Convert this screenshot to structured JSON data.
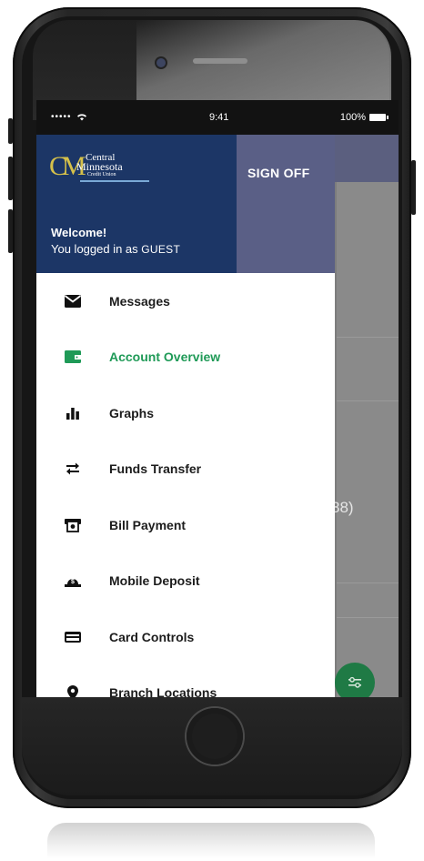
{
  "status_bar": {
    "signal": "•••••",
    "time": "9:41",
    "battery": "100%"
  },
  "header": {
    "logo": {
      "line1": "Central",
      "line2": "Minnesota",
      "line3": "Credit Union"
    },
    "sign_off_label": "SIGN OFF",
    "welcome": "Welcome!",
    "logged_in_prefix": "You logged in as ",
    "username": "GUEST"
  },
  "menu": {
    "items": [
      {
        "label": "Messages",
        "icon": "envelope-icon"
      },
      {
        "label": "Account Overview",
        "icon": "wallet-icon"
      },
      {
        "label": "Graphs",
        "icon": "bar-chart-icon"
      },
      {
        "label": "Funds Transfer",
        "icon": "transfer-arrows-icon"
      },
      {
        "label": "Bill Payment",
        "icon": "bill-icon"
      },
      {
        "label": "Mobile Deposit",
        "icon": "deposit-icon"
      },
      {
        "label": "Card Controls",
        "icon": "card-icon"
      },
      {
        "label": "Branch Locations",
        "icon": "location-pin-icon"
      }
    ],
    "active_index": 1
  },
  "background": {
    "partial_text": "88)"
  },
  "colors": {
    "header_bg": "#1c3666",
    "accent_green": "#1f9a57",
    "sign_off_bg": "#5a5f86"
  }
}
